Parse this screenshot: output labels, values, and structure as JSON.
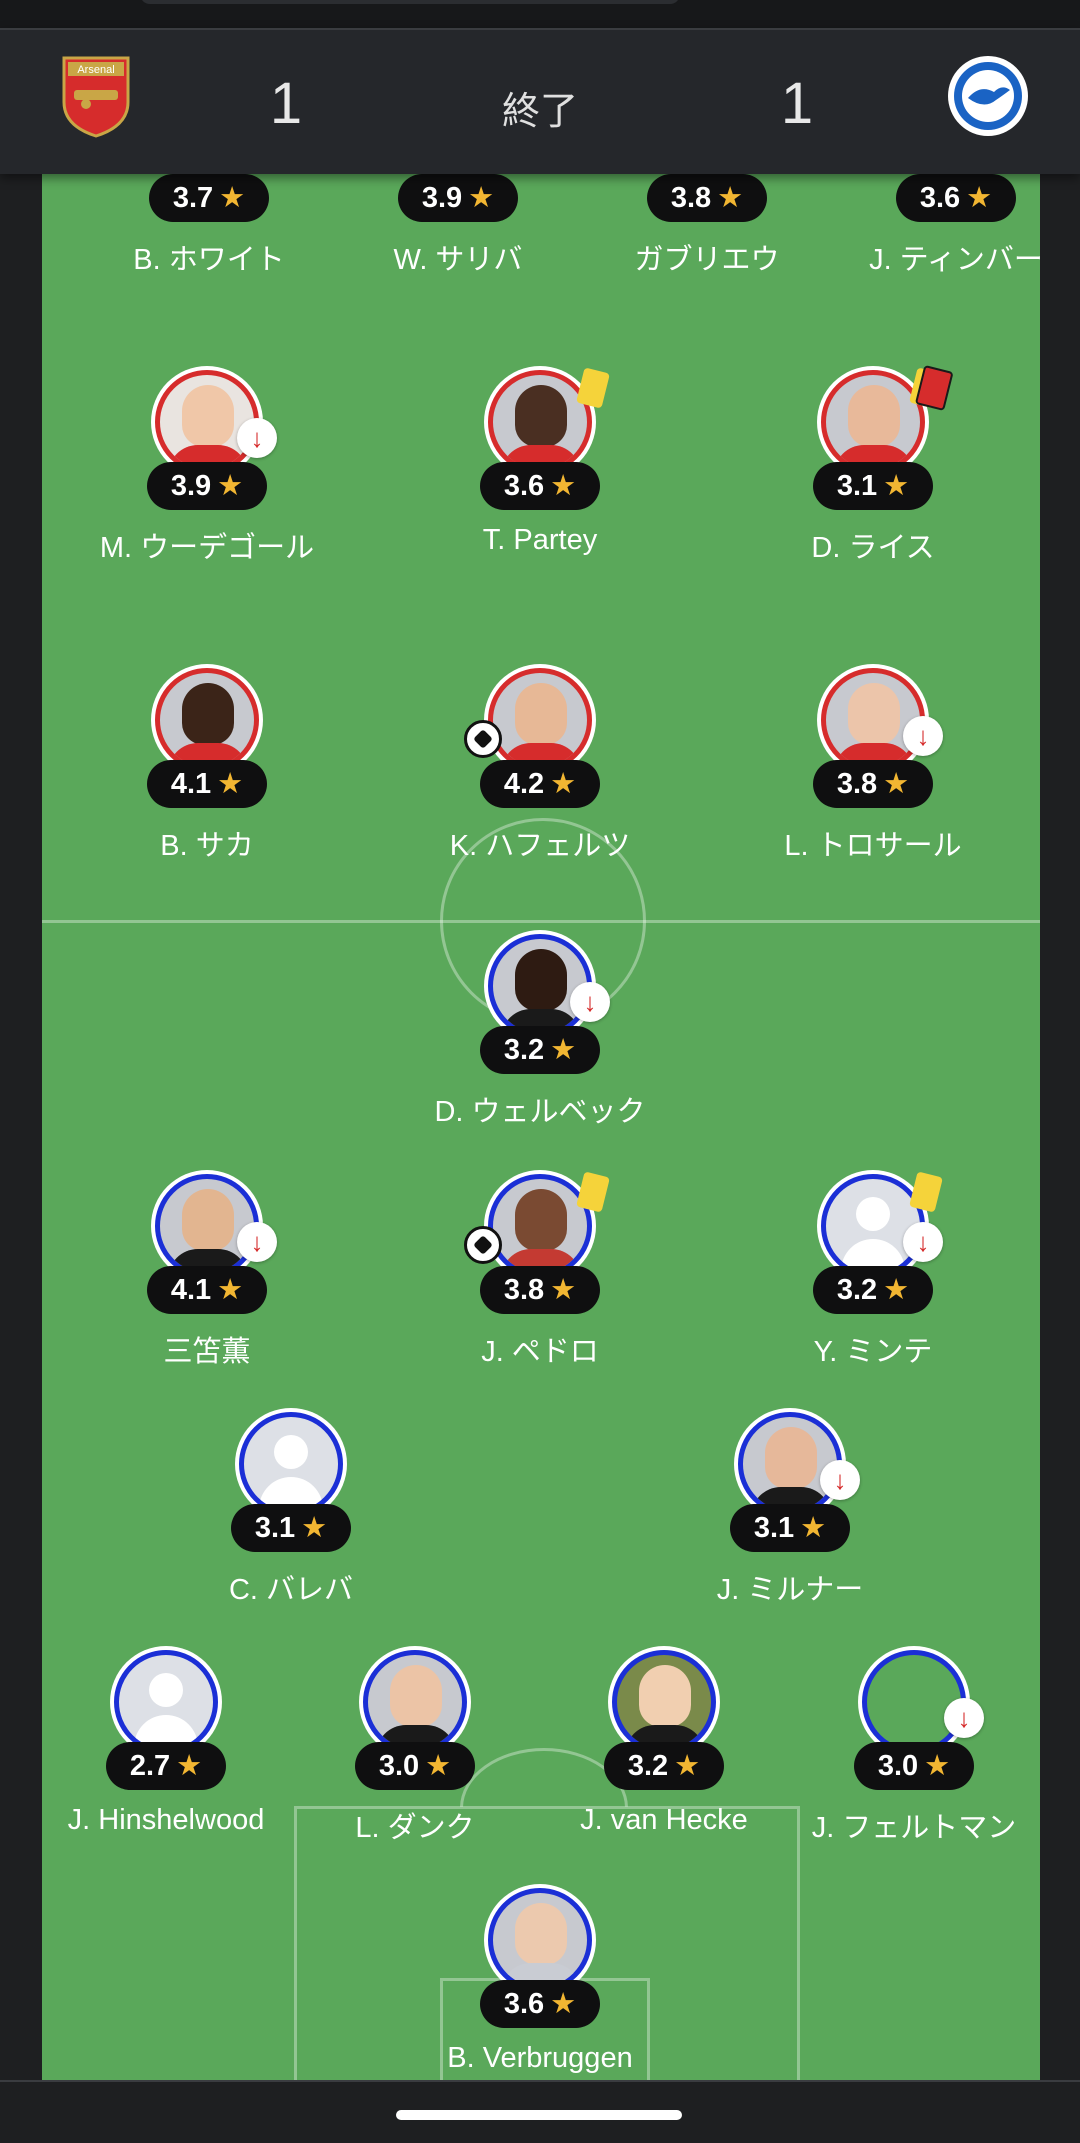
{
  "header": {
    "home_score": "1",
    "away_score": "1",
    "status": "終了",
    "home_crest": "arsenal-crest-icon",
    "away_crest": "brighton-crest-icon"
  },
  "colors": {
    "home": "#d62c2c",
    "away": "#1b2fd6",
    "pitch": "#5aa85a",
    "star": "#f2b632"
  },
  "players": {
    "white": {
      "name": "B. ホワイト",
      "rating": "3.7"
    },
    "saliba": {
      "name": "W. サリバ",
      "rating": "3.9"
    },
    "gabriel": {
      "name": "ガブリエウ",
      "rating": "3.8"
    },
    "timber": {
      "name": "J. ティンバー",
      "rating": "3.6"
    },
    "odegaard": {
      "name": "M. ウーデゴール",
      "rating": "3.9"
    },
    "partey": {
      "name": "T. Partey",
      "rating": "3.6"
    },
    "rice": {
      "name": "D. ライス",
      "rating": "3.1"
    },
    "saka": {
      "name": "B. サカ",
      "rating": "4.1"
    },
    "havertz": {
      "name": "K. ハフェルツ",
      "rating": "4.2"
    },
    "trossard": {
      "name": "L. トロサール",
      "rating": "3.8"
    },
    "welbeck": {
      "name": "D. ウェルベック",
      "rating": "3.2"
    },
    "mitoma": {
      "name": "三笘薫",
      "rating": "4.1"
    },
    "pedro": {
      "name": "J. ペドロ",
      "rating": "3.8"
    },
    "minteh": {
      "name": "Y. ミンテ",
      "rating": "3.2"
    },
    "baleba": {
      "name": "C. バレバ",
      "rating": "3.1"
    },
    "milner": {
      "name": "J. ミルナー",
      "rating": "3.1"
    },
    "hinshelwood": {
      "name": "J. Hinshelwood",
      "rating": "2.7"
    },
    "dunk": {
      "name": "L. ダンク",
      "rating": "3.0"
    },
    "vanhecke": {
      "name": "J. van Hecke",
      "rating": "3.2"
    },
    "veltman": {
      "name": "J. フェルトマン",
      "rating": "3.0"
    },
    "verbruggen": {
      "name": "B. Verbruggen",
      "rating": "3.6"
    }
  },
  "icons": {
    "star": "★",
    "sub_off": "↓"
  }
}
